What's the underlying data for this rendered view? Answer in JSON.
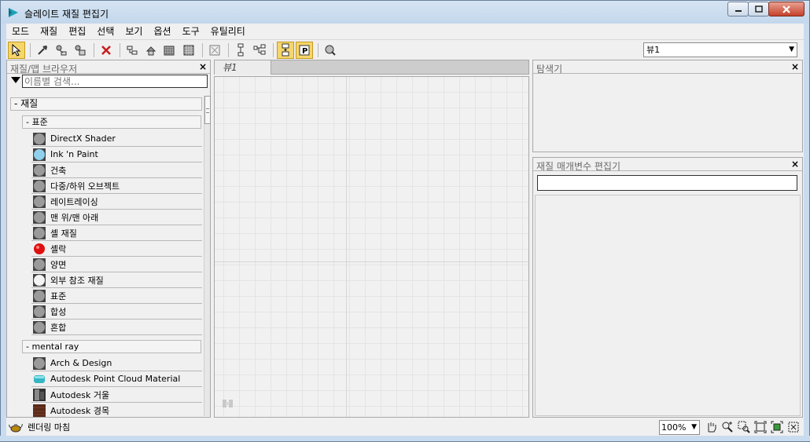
{
  "window": {
    "title": "슬레이트 재질 편집기"
  },
  "menu": [
    "모드",
    "재질",
    "편집",
    "선택",
    "보기",
    "옵션",
    "도구",
    "유틸리티"
  ],
  "toolbar": {
    "view_select": "뷰1"
  },
  "browser": {
    "title": "재질/맵 브라우저",
    "search_placeholder": "이름별 검색...",
    "group": "- 재질",
    "sub1": "- 표준",
    "items1": [
      {
        "label": "DirectX Shader",
        "swatch": "gray"
      },
      {
        "label": "Ink 'n Paint",
        "swatch": "lightblue"
      },
      {
        "label": "건축",
        "swatch": "gray"
      },
      {
        "label": "다중/하위 오브젝트",
        "swatch": "gray"
      },
      {
        "label": "레이트레이싱",
        "swatch": "gray"
      },
      {
        "label": "맨 위/맨 아래",
        "swatch": "gray"
      },
      {
        "label": "셸 재질",
        "swatch": "gray"
      },
      {
        "label": "셸락",
        "swatch": "red"
      },
      {
        "label": "양면",
        "swatch": "gray"
      },
      {
        "label": "외부 참조 재질",
        "swatch": "white"
      },
      {
        "label": "표준",
        "swatch": "gray"
      },
      {
        "label": "합성",
        "swatch": "gray"
      },
      {
        "label": "혼합",
        "swatch": "gray"
      }
    ],
    "sub2": "- mental ray",
    "items2": [
      {
        "label": "Arch & Design",
        "swatch": "gray"
      },
      {
        "label": "Autodesk Point Cloud Material",
        "swatch": "teal"
      },
      {
        "label": "Autodesk 거울",
        "swatch": "dark"
      },
      {
        "label": "Autodesk 경목",
        "swatch": "brown"
      }
    ]
  },
  "view": {
    "tab": "뷰1"
  },
  "navigator": {
    "title": "탐색기"
  },
  "param_editor": {
    "title": "재질 매개변수 편집기"
  },
  "status": {
    "text": "렌더링 마침",
    "zoom": "100%"
  }
}
